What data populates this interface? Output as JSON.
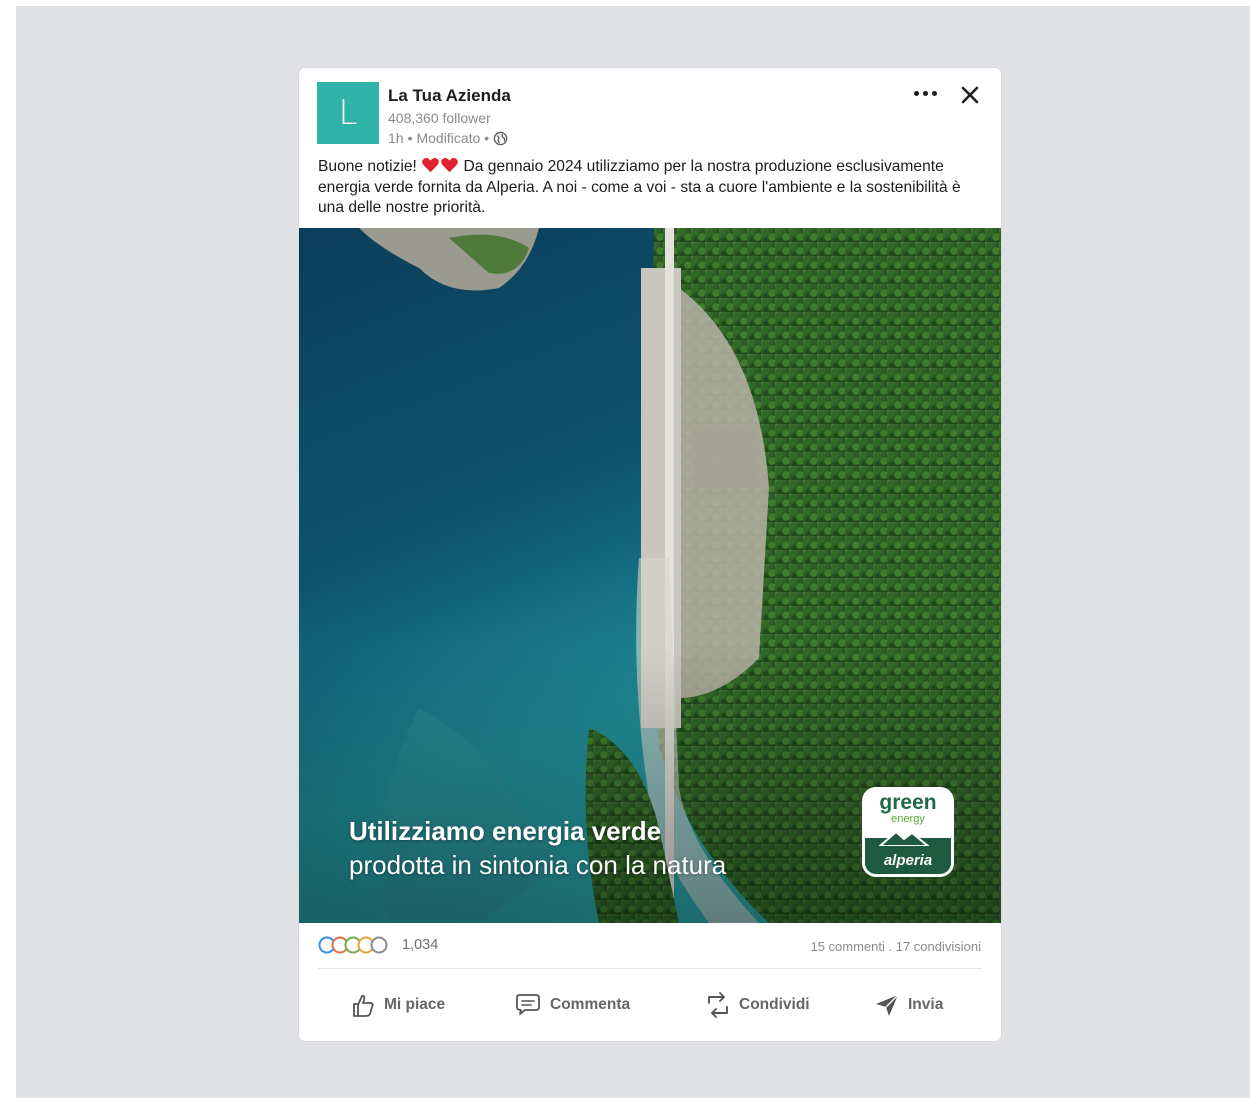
{
  "post": {
    "avatar_letter": "L",
    "company_name": "La Tua Azienda",
    "followers": "408,360 follower",
    "time": "1h",
    "edited": "Modificato",
    "separator": "•",
    "text_part1": "Buone notizie!",
    "text_part2": "Da gennaio 2024 utilizziamo per la nostra produzione esclusivamente energia verde fornita da Alperia. A noi - come a voi - sta a cuore l'ambiente e la sostenibilità è una delle nostre priorità."
  },
  "media": {
    "headline": "Utilizziamo energia verde",
    "subline": "prodotta in sintonia con la natura",
    "badge": {
      "word1": "green",
      "word2": "energy",
      "brand": "alperia"
    }
  },
  "stats": {
    "reactions_count": "1,034",
    "engagement": "15 commenti . 17 condivisioni"
  },
  "actions": {
    "like": "Mi piace",
    "comment": "Commenta",
    "share": "Condividi",
    "send": "Invia"
  },
  "colors": {
    "avatar": "#2fb2a8",
    "heart": "#e0202a",
    "badge_dark": "#1d5a3f"
  }
}
